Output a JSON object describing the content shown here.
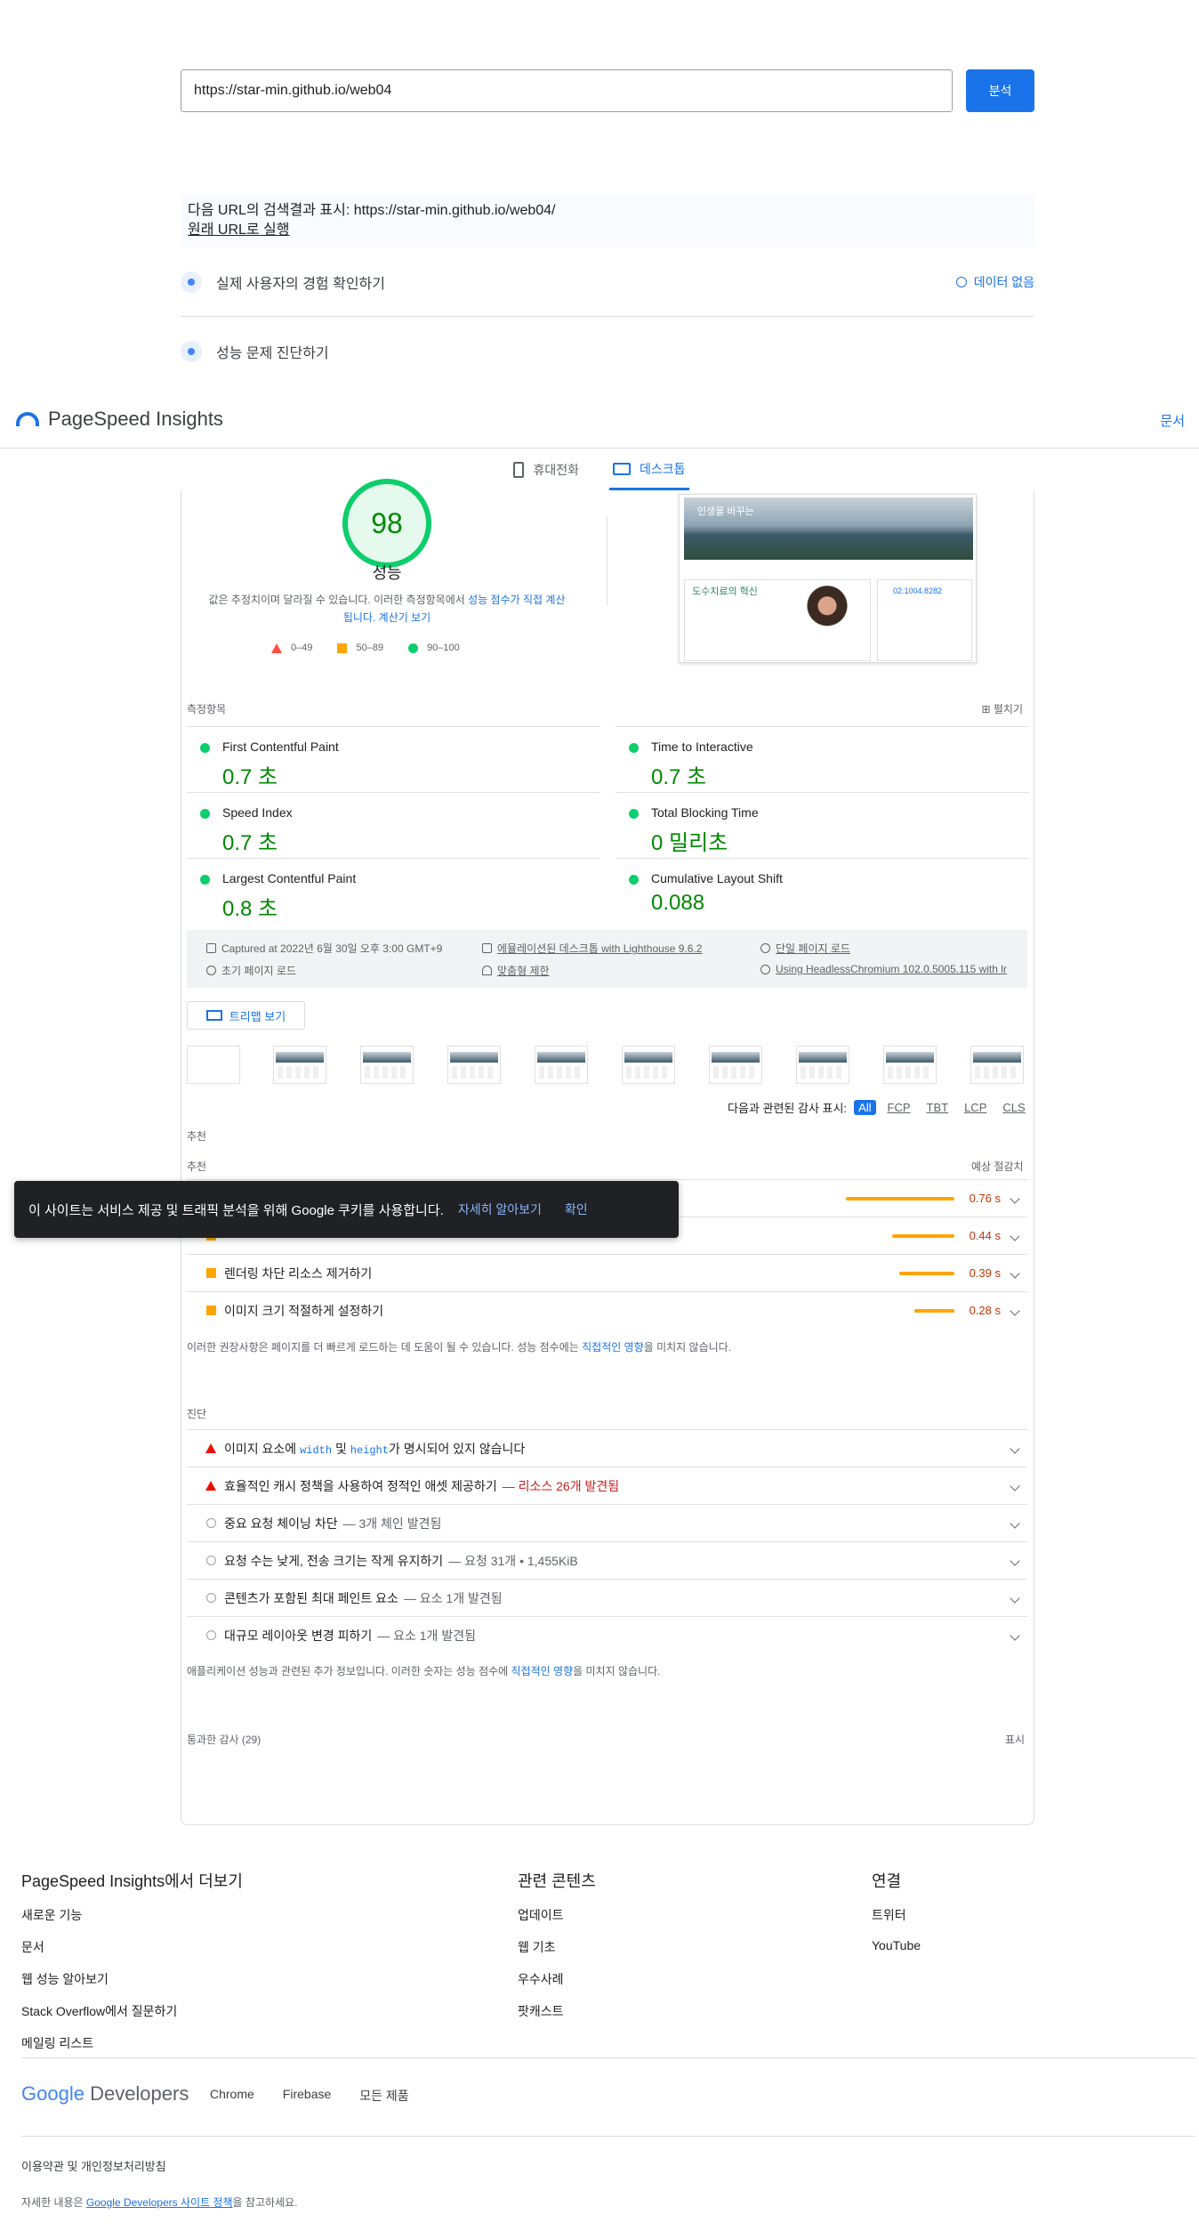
{
  "search": {
    "url_value": "https://star-min.github.io/web04",
    "analyze_label": "분석"
  },
  "notice": {
    "text": "다음 URL의 검색결과 표시: https://star-min.github.io/web04/",
    "original_link": "원래 URL로 실행"
  },
  "sections": {
    "real_user": "실제 사용자의 경험 확인하기",
    "no_data": "데이터 없음",
    "diagnose": "성능 문제 진단하기"
  },
  "header": {
    "title": "PageSpeed Insights",
    "docs": "문서"
  },
  "tabs": [
    {
      "label": "휴대전화"
    },
    {
      "label": "데스크톱"
    }
  ],
  "score": {
    "value": "98",
    "title": "성능",
    "desc_a": "값은 추정치이며 달라질 수 있습니다. 이러한 측정항목에서 ",
    "desc_link": "성능 점수가 직접 계산됩니다.",
    "desc_b": " 계산기 보기",
    "legend": [
      "0–49",
      "50–89",
      "90–100"
    ]
  },
  "screenshot": {
    "hero_title": "인생을 바꾸는",
    "card_title": "도수치료의 혁신",
    "phone": "02.1004.8282"
  },
  "metrics": {
    "heading": "측정항목",
    "expand": "펼치기",
    "items": [
      {
        "name": "First Contentful Paint",
        "value": "0.7 초"
      },
      {
        "name": "Time to Interactive",
        "value": "0.7 초"
      },
      {
        "name": "Speed Index",
        "value": "0.7 초"
      },
      {
        "name": "Total Blocking Time",
        "value": "0 밀리초"
      },
      {
        "name": "Largest Contentful Paint",
        "value": "0.8 초"
      },
      {
        "name": "Cumulative Layout Shift",
        "value": "0.088"
      }
    ]
  },
  "env": {
    "captured": "Captured at 2022년 6월 30일 오후 3:00 GMT+9",
    "initial_load": "초기 페이지 로드",
    "emulated": "에뮬레이션된 데스크톱 with Lighthouse 9.6.2",
    "throttle": "맞춤형 제한",
    "single_load": "단일 페이지 로드",
    "browser": "Using HeadlessChromium 102.0.5005.115 with lr"
  },
  "treemap_label": "트리맵 보기",
  "filter": {
    "label": "다음과 관련된 감사 표시:",
    "chips": [
      "All",
      "FCP",
      "TBT",
      "LCP",
      "CLS"
    ]
  },
  "opportunities": {
    "heading": "추천",
    "subheading": "추천",
    "savings_label": "예상 절감치",
    "items": [
      {
        "label": "",
        "ms": "0.76 s",
        "fraction": 0.76
      },
      {
        "label": "",
        "ms": "0.44 s",
        "fraction": 0.44
      },
      {
        "label": "렌더링 차단 리소스 제거하기",
        "ms": "0.39 s",
        "fraction": 0.39
      },
      {
        "label": "이미지 크기 적절하게 설정하기",
        "ms": "0.28 s",
        "fraction": 0.28
      }
    ],
    "note_a": "이러한 권장사항은 페이지를 더 빠르게 로드하는 데 도움이 될 수 있습니다. 성능 점수에는 ",
    "note_link": "직접적인 영향",
    "note_b": "을 미치지 않습니다."
  },
  "diagnostics": {
    "heading": "진단",
    "items": [
      {
        "pre": "이미지 요소에 ",
        "code1": "width",
        "mid": " 및 ",
        "code2": "height",
        "post": "가 명시되어 있지 않습니다"
      },
      {
        "label": "효율적인 캐시 정책을 사용하여 정적인 애셋 제공하기",
        "detail": "— 리소스 26개 발견됨"
      },
      {
        "label": "중요 요청 체이닝 차단",
        "detail": "— 3개 체인 발견됨"
      },
      {
        "label": "요청 수는 낮게, 전송 크기는 작게 유지하기",
        "detail": "— 요청 31개 • 1,455KiB"
      },
      {
        "label": "콘텐츠가 포함된 최대 페인트 요소",
        "detail": "— 요소 1개 발견됨"
      },
      {
        "label": "대규모 레이아웃 변경 피하기",
        "detail": "— 요소 1개 발견됨"
      }
    ],
    "note_a": "애플리케이션 성능과 관련된 추가 정보입니다. 이러한 숫자는 성능 점수에 ",
    "note_link": "직접적인 영향",
    "note_b": "을 미치지 않습니다."
  },
  "passed": {
    "label": "통과한 감사 (29)",
    "show": "표시"
  },
  "cookie": {
    "text": "이 사이트는 서비스 제공 및 트래픽 분석을 위해 Google 쿠키를 사용합니다.",
    "more": "자세히 알아보기",
    "ok": "확인"
  },
  "footer": {
    "col1": {
      "title_a": "PageSpeed Insights",
      "title_b": "에서 더보기",
      "links": [
        "새로운 기능",
        "문서",
        "웹 성능 알아보기",
        "Stack Overflow에서 질문하기",
        "메일링 리스트"
      ]
    },
    "col2": {
      "title": "관련 콘텐츠",
      "links": [
        "업데이트",
        "웹 기초",
        "우수사례",
        "팟캐스트"
      ]
    },
    "col3": {
      "title": "연결",
      "links": [
        "트위터",
        "YouTube"
      ]
    },
    "brand_google": "Google",
    "brand_dev": " Developers",
    "brand_links": [
      "Chrome",
      "Firebase",
      "모든 제품"
    ],
    "terms": "이용약관 및 개인정보처리방침",
    "license_a": "자세한 내용은 ",
    "license_link": "Google Developers 사이트 정책",
    "license_b": "을 참고하세요."
  },
  "colors": {
    "accent": "#1a73e8",
    "good": "#0cce6b",
    "average": "#ffa400",
    "poor": "#ff4e42"
  }
}
